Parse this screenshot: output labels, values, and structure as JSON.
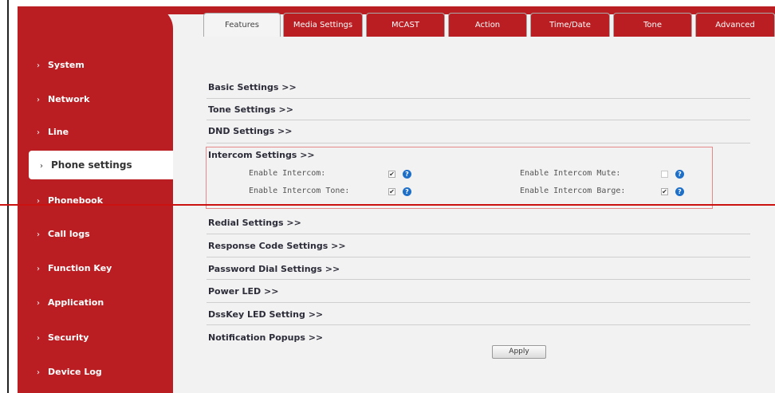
{
  "sidebar": {
    "items": [
      {
        "label": "System"
      },
      {
        "label": "Network"
      },
      {
        "label": "Line"
      },
      {
        "label": "Phone settings"
      },
      {
        "label": "Phonebook"
      },
      {
        "label": "Call logs"
      },
      {
        "label": "Function Key"
      },
      {
        "label": "Application"
      },
      {
        "label": "Security"
      },
      {
        "label": "Device Log"
      }
    ],
    "active": "Phone settings"
  },
  "tabs": [
    {
      "label": "Features"
    },
    {
      "label": "Media Settings"
    },
    {
      "label": "MCAST"
    },
    {
      "label": "Action"
    },
    {
      "label": "Time/Date"
    },
    {
      "label": "Tone"
    },
    {
      "label": "Advanced"
    }
  ],
  "sections": [
    {
      "label": "Basic Settings >>"
    },
    {
      "label": "Tone Settings >>"
    },
    {
      "label": "DND Settings >>"
    },
    {
      "label": "Intercom Settings >>"
    },
    {
      "label": "Redial Settings >>"
    },
    {
      "label": "Response Code Settings >>"
    },
    {
      "label": "Password Dial Settings >>"
    },
    {
      "label": "Power LED >>"
    },
    {
      "label": "DssKey LED Setting >>"
    },
    {
      "label": "Notification Popups >>"
    }
  ],
  "intercom": {
    "options": [
      {
        "label": "Enable Intercom:",
        "checked": true
      },
      {
        "label": "Enable Intercom Mute:",
        "checked": false
      },
      {
        "label": "Enable Intercom Tone:",
        "checked": true
      },
      {
        "label": "Enable Intercom Barge:",
        "checked": true
      }
    ]
  },
  "check_mark": "✔",
  "help_glyph": "?",
  "apply_label": "Apply",
  "colors": {
    "brand_red": "#bb1e22",
    "help_blue": "#1e6fc8",
    "highlight_border": "#e48a8a"
  }
}
